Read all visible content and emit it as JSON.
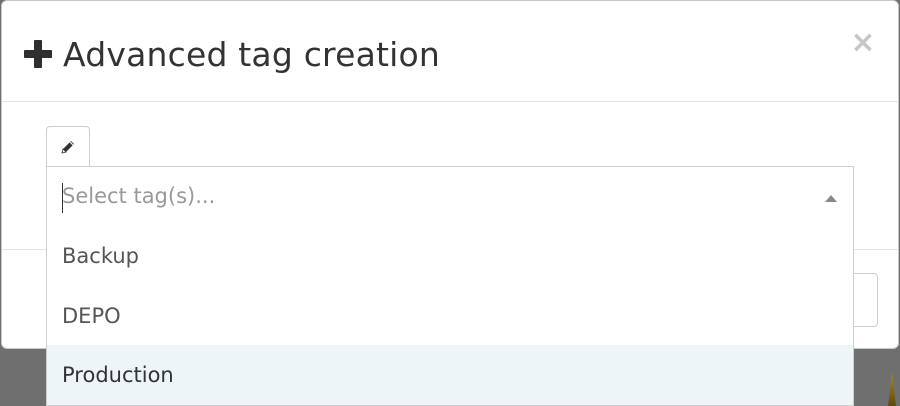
{
  "modal": {
    "title": "Advanced tag creation",
    "title_icon": "plus-icon",
    "close_label": "×"
  },
  "toolbar": {
    "edit_icon": "pencil-icon"
  },
  "tag_select": {
    "value": "",
    "placeholder": "Select tag(s)...",
    "arrow_icon": "caret-up-icon",
    "options": [
      {
        "label": "Backup",
        "highlighted": false
      },
      {
        "label": "DEPO",
        "highlighted": false
      },
      {
        "label": "Production",
        "highlighted": true
      }
    ]
  },
  "colors": {
    "backdrop": "#6f6f6f",
    "highlight": "#eef5f9",
    "placeholder": "#999999",
    "close": "#c7c7c7"
  }
}
